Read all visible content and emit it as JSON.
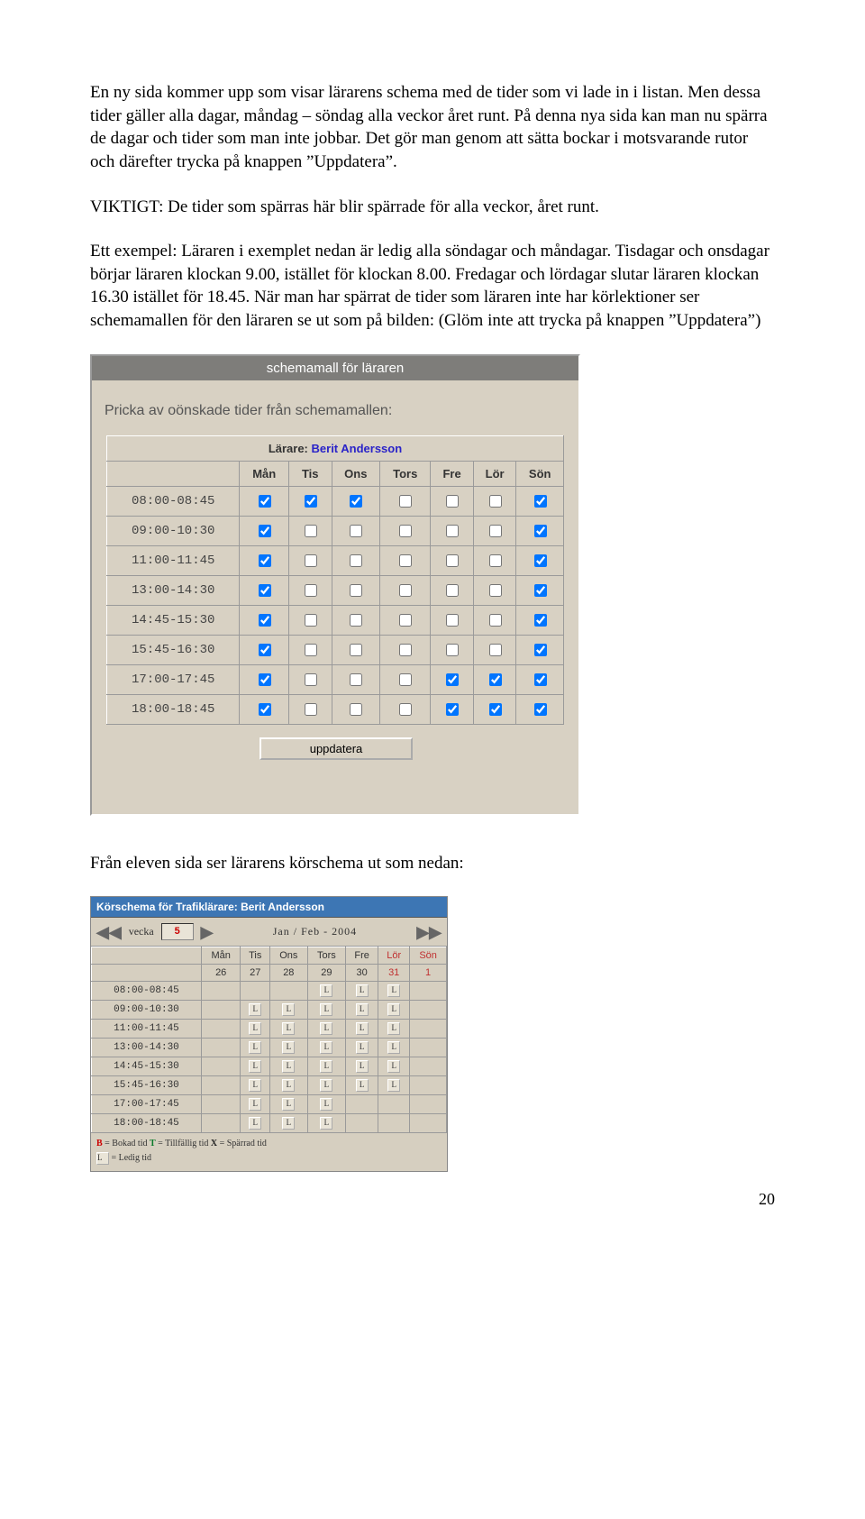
{
  "para1": "En ny sida kommer upp som visar lärarens schema med de tider som vi lade in i listan. Men dessa tider gäller alla dagar, måndag – söndag alla veckor året runt. På denna nya sida kan man nu spärra de dagar och tider som man inte jobbar. Det gör man genom att sätta bockar i motsvarande rutor och därefter trycka på knappen ”Uppdatera”.",
  "para2": "VIKTIGT: De tider som spärras här blir spärrade för alla veckor, året runt.",
  "para3": "Ett exempel: Läraren i exemplet nedan är ledig alla söndagar och måndagar. Tisdagar och onsdagar börjar läraren klockan 9.00, istället för klockan 8.00. Fredagar och lördagar slutar läraren klockan 16.30 istället för 18.45. När man har spärrat de tider som läraren inte har körlektioner ser schemamallen för den läraren se ut som på bilden: (Glöm inte att trycka på knappen ”Uppdatera”)",
  "panel1": {
    "title": "schemamall för läraren",
    "subtitle": "Pricka av oönskade tider från schemamallen:",
    "teacher_label": "Lärare:",
    "teacher_name": "Berit Andersson",
    "days": [
      "Mån",
      "Tis",
      "Ons",
      "Tors",
      "Fre",
      "Lör",
      "Sön"
    ],
    "times": [
      "08:00-08:45",
      "09:00-10:30",
      "11:00-11:45",
      "13:00-14:30",
      "14:45-15:30",
      "15:45-16:30",
      "17:00-17:45",
      "18:00-18:45"
    ],
    "checks": [
      [
        true,
        true,
        true,
        false,
        false,
        false,
        true
      ],
      [
        true,
        false,
        false,
        false,
        false,
        false,
        true
      ],
      [
        true,
        false,
        false,
        false,
        false,
        false,
        true
      ],
      [
        true,
        false,
        false,
        false,
        false,
        false,
        true
      ],
      [
        true,
        false,
        false,
        false,
        false,
        false,
        true
      ],
      [
        true,
        false,
        false,
        false,
        false,
        false,
        true
      ],
      [
        true,
        false,
        false,
        false,
        true,
        true,
        true
      ],
      [
        true,
        false,
        false,
        false,
        true,
        true,
        true
      ]
    ],
    "update_btn": "uppdatera"
  },
  "para4": "Från eleven sida ser lärarens körschema ut som nedan:",
  "panel2": {
    "title": "Körschema för Trafiklärare: Berit Andersson",
    "week_label": "vecka",
    "week_no": "5",
    "month": "Jan / Feb - 2004",
    "days": [
      "Mån",
      "Tis",
      "Ons",
      "Tors",
      "Fre",
      "Lör",
      "Sön"
    ],
    "dates": [
      "26",
      "27",
      "28",
      "29",
      "30",
      "31",
      "1"
    ],
    "weekend_cols": [
      5,
      6
    ],
    "times": [
      "08:00-08:45",
      "09:00-10:30",
      "11:00-11:45",
      "13:00-14:30",
      "14:45-15:30",
      "15:45-16:30",
      "17:00-17:45",
      "18:00-18:45"
    ],
    "cells": [
      [
        "",
        "",
        "",
        "L",
        "L",
        "L",
        ""
      ],
      [
        "",
        "L",
        "L",
        "L",
        "L",
        "L",
        ""
      ],
      [
        "",
        "L",
        "L",
        "L",
        "L",
        "L",
        ""
      ],
      [
        "",
        "L",
        "L",
        "L",
        "L",
        "L",
        ""
      ],
      [
        "",
        "L",
        "L",
        "L",
        "L",
        "L",
        ""
      ],
      [
        "",
        "L",
        "L",
        "L",
        "L",
        "L",
        ""
      ],
      [
        "",
        "L",
        "L",
        "L",
        "",
        "",
        ""
      ],
      [
        "",
        "L",
        "L",
        "L",
        "",
        "",
        ""
      ]
    ],
    "legend": {
      "b_key": "B",
      "b_txt": " = Bokad tid   ",
      "t_key": "T",
      "t_txt": " = Tillfällig tid   ",
      "x_key": "X",
      "x_txt": " = Spärrad tid",
      "l_txt": " = Ledig tid"
    }
  },
  "pagenum": "20"
}
